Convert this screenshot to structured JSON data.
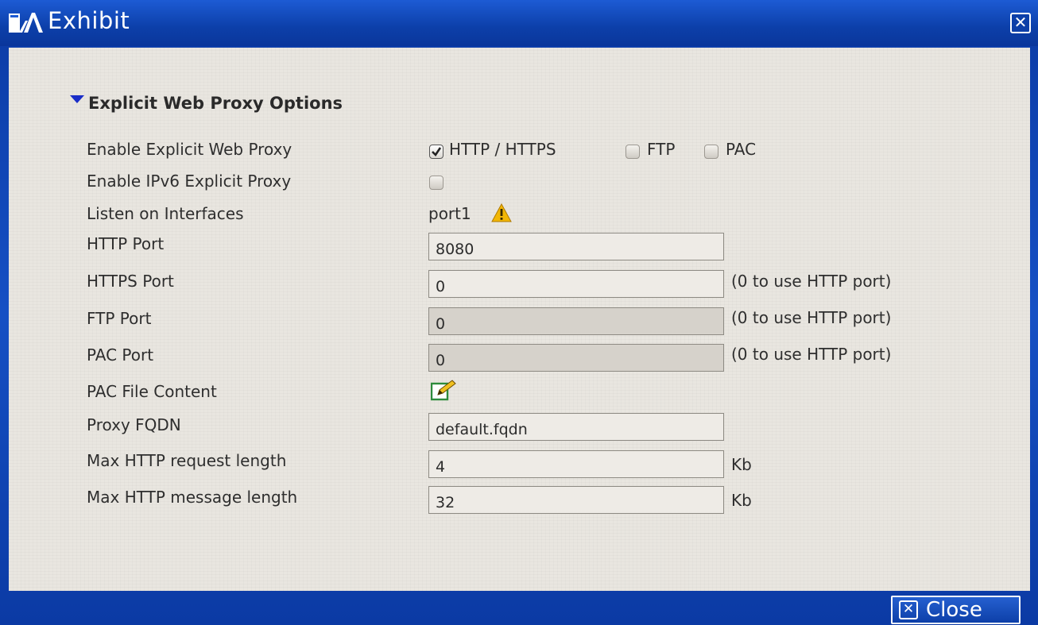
{
  "window": {
    "title": "Exhibit",
    "close_symbol": "✕",
    "close_label": "Close"
  },
  "section": {
    "title": "Explicit Web Proxy Options"
  },
  "fields": {
    "enable_explicit_web_proxy": {
      "label": "Enable Explicit Web Proxy",
      "options": [
        {
          "label": "HTTP / HTTPS",
          "checked": true
        },
        {
          "label": "FTP",
          "checked": false
        },
        {
          "label": "PAC",
          "checked": false
        }
      ]
    },
    "enable_ipv6_explicit_proxy": {
      "label": "Enable IPv6 Explicit Proxy",
      "checked": false
    },
    "listen_on_interfaces": {
      "label": "Listen on Interfaces",
      "value": "port1",
      "icon": "warning-icon"
    },
    "http_port": {
      "label": "HTTP Port",
      "value": "8080"
    },
    "https_port": {
      "label": "HTTPS Port",
      "value": "0",
      "hint": "(0 to use HTTP port)"
    },
    "ftp_port": {
      "label": "FTP Port",
      "value": "0",
      "hint": "(0 to use HTTP port)"
    },
    "pac_port": {
      "label": "PAC Port",
      "value": "0",
      "hint": "(0 to use HTTP port)"
    },
    "pac_file_content": {
      "label": "PAC File Content",
      "icon": "edit-icon"
    },
    "proxy_fqdn": {
      "label": "Proxy FQDN",
      "value": "default.fqdn"
    },
    "max_http_request_length": {
      "label": "Max HTTP request length",
      "value": "4",
      "unit": "Kb"
    },
    "max_http_message_length": {
      "label": "Max HTTP message length",
      "value": "32",
      "unit": "Kb"
    }
  },
  "colors": {
    "titlebar": "#0c3fa9",
    "panel": "#e9e6e0",
    "section_arrow": "#1a2ec8",
    "warning": "#f2b705",
    "edit_icon_green": "#2e8b3c"
  }
}
